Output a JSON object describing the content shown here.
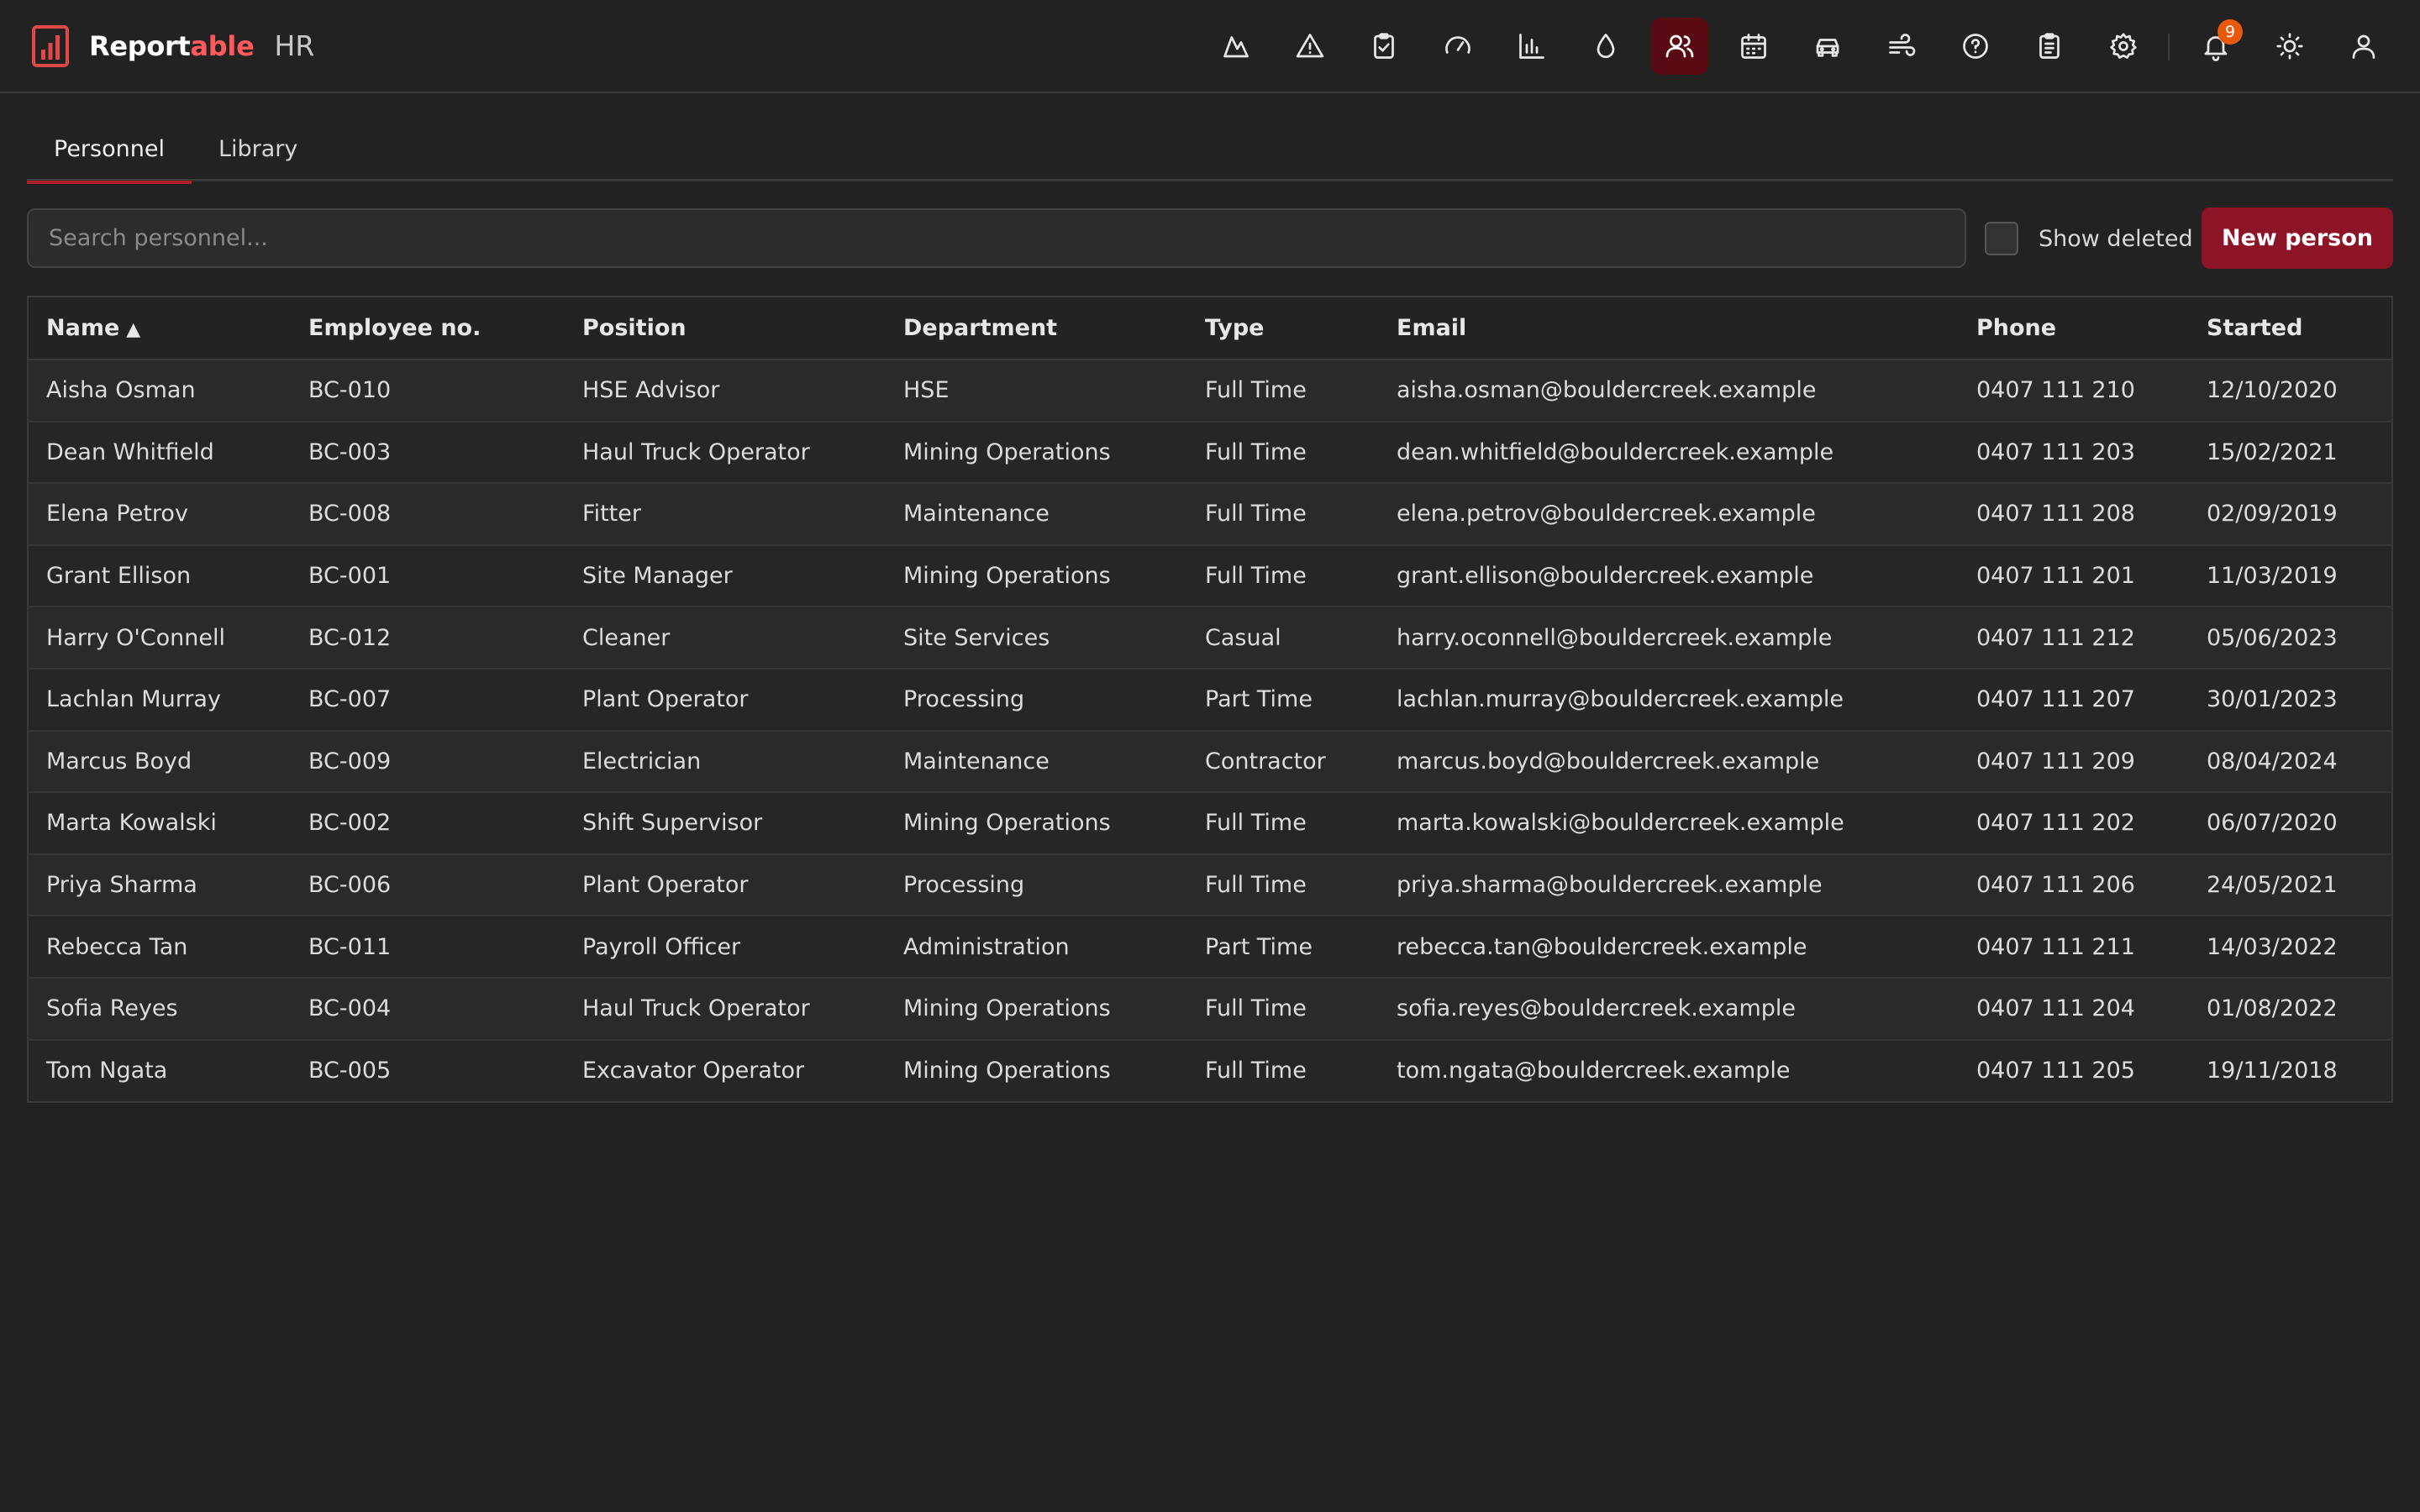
{
  "brand": {
    "name_start": "Report",
    "name_accent": "able",
    "section": "HR",
    "accent_color": "#ff5a5a"
  },
  "nav": {
    "icons": [
      "mountain-icon",
      "warning-icon",
      "clipboard-check-icon",
      "gauge-icon",
      "bar-chart-icon",
      "droplet-icon",
      "users-icon",
      "calendar-icon",
      "vehicle-icon",
      "wind-icon",
      "help-icon",
      "clipboard-list-icon",
      "gear-icon",
      "bell-icon",
      "sun-icon",
      "user-icon"
    ],
    "active": "users-icon",
    "notification_count": "9",
    "active_color": "#5a0a12",
    "badge_color": "#e8590c"
  },
  "tabs": [
    {
      "label": "Personnel",
      "active": true
    },
    {
      "label": "Library",
      "active": false
    }
  ],
  "toolbar": {
    "search_placeholder": "Search personnel...",
    "search_value": "",
    "show_deleted_label": "Show deleted",
    "show_deleted_checked": false,
    "new_button_label": "New person",
    "button_color": "#8d1426"
  },
  "table": {
    "columns": [
      "Name",
      "Employee no.",
      "Position",
      "Department",
      "Type",
      "Email",
      "Phone",
      "Started"
    ],
    "sort_column": "Name",
    "sort_indicator": "▲",
    "rows": [
      [
        "Aisha Osman",
        "BC-010",
        "HSE Advisor",
        "HSE",
        "Full Time",
        "aisha.osman@bouldercreek.example",
        "0407 111 210",
        "12/10/2020"
      ],
      [
        "Dean Whitfield",
        "BC-003",
        "Haul Truck Operator",
        "Mining Operations",
        "Full Time",
        "dean.whitfield@bouldercreek.example",
        "0407 111 203",
        "15/02/2021"
      ],
      [
        "Elena Petrov",
        "BC-008",
        "Fitter",
        "Maintenance",
        "Full Time",
        "elena.petrov@bouldercreek.example",
        "0407 111 208",
        "02/09/2019"
      ],
      [
        "Grant Ellison",
        "BC-001",
        "Site Manager",
        "Mining Operations",
        "Full Time",
        "grant.ellison@bouldercreek.example",
        "0407 111 201",
        "11/03/2019"
      ],
      [
        "Harry O'Connell",
        "BC-012",
        "Cleaner",
        "Site Services",
        "Casual",
        "harry.oconnell@bouldercreek.example",
        "0407 111 212",
        "05/06/2023"
      ],
      [
        "Lachlan Murray",
        "BC-007",
        "Plant Operator",
        "Processing",
        "Part Time",
        "lachlan.murray@bouldercreek.example",
        "0407 111 207",
        "30/01/2023"
      ],
      [
        "Marcus Boyd",
        "BC-009",
        "Electrician",
        "Maintenance",
        "Contractor",
        "marcus.boyd@bouldercreek.example",
        "0407 111 209",
        "08/04/2024"
      ],
      [
        "Marta Kowalski",
        "BC-002",
        "Shift Supervisor",
        "Mining Operations",
        "Full Time",
        "marta.kowalski@bouldercreek.example",
        "0407 111 202",
        "06/07/2020"
      ],
      [
        "Priya Sharma",
        "BC-006",
        "Plant Operator",
        "Processing",
        "Full Time",
        "priya.sharma@bouldercreek.example",
        "0407 111 206",
        "24/05/2021"
      ],
      [
        "Rebecca Tan",
        "BC-011",
        "Payroll Officer",
        "Administration",
        "Part Time",
        "rebecca.tan@bouldercreek.example",
        "0407 111 211",
        "14/03/2022"
      ],
      [
        "Sofia Reyes",
        "BC-004",
        "Haul Truck Operator",
        "Mining Operations",
        "Full Time",
        "sofia.reyes@bouldercreek.example",
        "0407 111 204",
        "01/08/2022"
      ],
      [
        "Tom Ngata",
        "BC-005",
        "Excavator Operator",
        "Mining Operations",
        "Full Time",
        "tom.ngata@bouldercreek.example",
        "0407 111 205",
        "19/11/2018"
      ]
    ]
  }
}
